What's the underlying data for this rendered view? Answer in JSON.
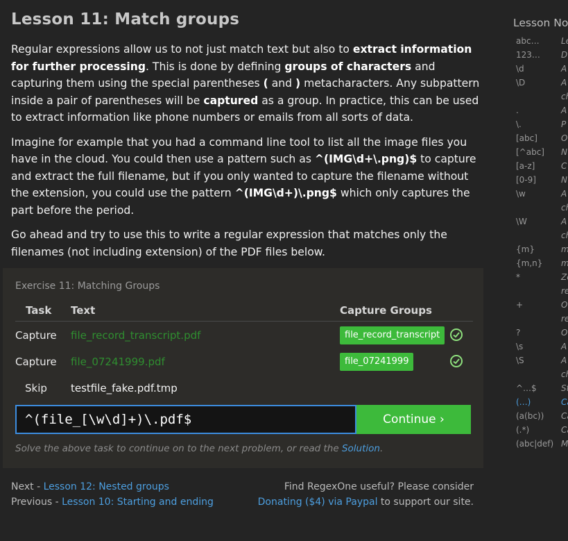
{
  "lesson": {
    "title": "Lesson 11: Match groups",
    "p1": [
      {
        "t": "Regular expressions allow us to not just match text but also to ",
        "b": false
      },
      {
        "t": "extract information for further processing",
        "b": true
      },
      {
        "t": ". This is done by defining ",
        "b": false
      },
      {
        "t": "groups of characters",
        "b": true
      },
      {
        "t": " and capturing them using the special parentheses ",
        "b": false
      },
      {
        "t": "(",
        "b": true
      },
      {
        "t": " and ",
        "b": false
      },
      {
        "t": ")",
        "b": true
      },
      {
        "t": " metacharacters. Any subpattern inside a pair of parentheses will be ",
        "b": false
      },
      {
        "t": "captured",
        "b": true
      },
      {
        "t": " as a group. In practice, this can be used to extract information like phone numbers or emails from all sorts of data.",
        "b": false
      }
    ],
    "p2": [
      {
        "t": "Imagine for example that you had a command line tool to list all the image files you have in the cloud. You could then use a pattern such as ",
        "b": false
      },
      {
        "t": "^(IMG\\d+\\.png)$",
        "b": true
      },
      {
        "t": " to capture and extract the full filename, but if you only wanted to capture the filename without the extension, you could use the pattern ",
        "b": false
      },
      {
        "t": "^(IMG\\d+)\\.png$",
        "b": true
      },
      {
        "t": " which only captures the part before the period.",
        "b": false
      }
    ],
    "p3": [
      {
        "t": "Go ahead and try to use this to write a regular expression that matches only the filenames (not including extension) of the PDF files below.",
        "b": false
      }
    ]
  },
  "exercise": {
    "title": "Exercise 11: Matching Groups",
    "headers": {
      "task": "Task",
      "text": "Text",
      "capture": "Capture Groups"
    },
    "rows": [
      {
        "task": "Capture",
        "text": "file_record_transcript.pdf",
        "group": "file_record_transcript"
      },
      {
        "task": "Capture",
        "text": "file_07241999.pdf",
        "group": "file_07241999"
      },
      {
        "task": "Skip",
        "text": "testfile_fake.pdf.tmp",
        "group": ""
      }
    ],
    "input_value": "^(file_[\\w\\d]+)\\.pdf$",
    "continue_label": "Continue ›",
    "hint_pre": "Solve the above task to continue on to the next problem, or read the ",
    "hint_link": "Solution",
    "hint_post": "."
  },
  "footer": {
    "next_prefix": "Next - ",
    "next_link": "Lesson 12: Nested groups",
    "prev_prefix": "Previous - ",
    "prev_link": "Lesson 10: Starting and ending",
    "donate_line": "Find RegexOne useful? Please consider",
    "donate_link": "Donating ($4) via Paypal",
    "donate_suffix": " to support our site."
  },
  "sidebar": {
    "title": "Lesson No",
    "items": [
      {
        "k": "abc…",
        "v": "Le"
      },
      {
        "k": "123…",
        "v": "D"
      },
      {
        "k": "\\d",
        "v": "A"
      },
      {
        "k": "\\D",
        "v": "A"
      },
      {
        "k": "",
        "v": "ch"
      },
      {
        "k": ".",
        "v": "A"
      },
      {
        "k": "\\.",
        "v": "P"
      },
      {
        "k": "[abc]",
        "v": "O"
      },
      {
        "k": "[^abc]",
        "v": "N"
      },
      {
        "k": "[a-z]",
        "v": "C"
      },
      {
        "k": "[0-9]",
        "v": "N"
      },
      {
        "k": "\\w",
        "v": "A"
      },
      {
        "k": "",
        "v": "ch"
      },
      {
        "k": "\\W",
        "v": "A"
      },
      {
        "k": "",
        "v": "ch"
      },
      {
        "k": "{m}",
        "v": "m"
      },
      {
        "k": "{m,n}",
        "v": "m"
      },
      {
        "k": "*",
        "v": "Ze"
      },
      {
        "k": "",
        "v": "re"
      },
      {
        "k": "+",
        "v": "O"
      },
      {
        "k": "",
        "v": "re"
      },
      {
        "k": "?",
        "v": "O"
      },
      {
        "k": "\\s",
        "v": "A"
      },
      {
        "k": "\\S",
        "v": "A"
      },
      {
        "k": "",
        "v": "ch"
      },
      {
        "k": "^…$",
        "v": "St"
      },
      {
        "k": "(…)",
        "v": "Ca"
      },
      {
        "k": "(a(bc))",
        "v": "Ca"
      },
      {
        "k": "(.*)",
        "v": "Ca"
      },
      {
        "k": "(abc|def)",
        "v": "M"
      }
    ]
  },
  "colors": {
    "background": "#242424",
    "panel": "#2d2c29",
    "accent_green": "#3dba3b",
    "link_blue": "#4d9fe0",
    "input_border": "#3c8de0"
  }
}
